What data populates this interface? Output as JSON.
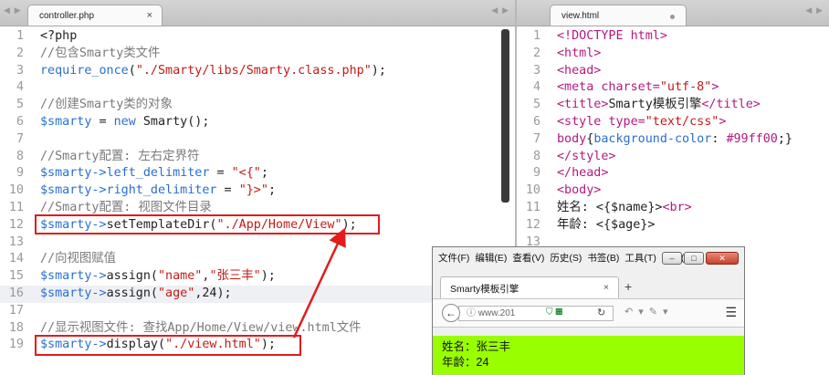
{
  "left_editor": {
    "tab_title": "controller.php",
    "tab_close": "×",
    "lines": [
      {
        "n": "1",
        "segs": [
          [
            "",
            "<?php"
          ]
        ]
      },
      {
        "n": "2",
        "segs": [
          [
            "com",
            "//包含Smarty类文件"
          ]
        ]
      },
      {
        "n": "3",
        "segs": [
          [
            "fn",
            "require_once"
          ],
          [
            "",
            "("
          ],
          [
            "str",
            "\"./Smarty/libs/Smarty.class.php\""
          ],
          [
            "",
            ");"
          ]
        ]
      },
      {
        "n": "4",
        "segs": []
      },
      {
        "n": "5",
        "segs": [
          [
            "com",
            "//创建Smarty类的对象"
          ]
        ]
      },
      {
        "n": "6",
        "segs": [
          [
            "var",
            "$smarty"
          ],
          [
            "",
            " = "
          ],
          [
            "kw",
            "new"
          ],
          [
            "",
            " Smarty();"
          ]
        ]
      },
      {
        "n": "7",
        "segs": []
      },
      {
        "n": "8",
        "segs": [
          [
            "com",
            "//Smarty配置: 左右定界符"
          ]
        ]
      },
      {
        "n": "9",
        "segs": [
          [
            "var",
            "$smarty->"
          ],
          [
            "fn",
            "left_delimiter"
          ],
          [
            "",
            " = "
          ],
          [
            "str",
            "\"<{\""
          ],
          [
            "",
            ";"
          ]
        ]
      },
      {
        "n": "10",
        "segs": [
          [
            "var",
            "$smarty->"
          ],
          [
            "fn",
            "right_delimiter"
          ],
          [
            "",
            " = "
          ],
          [
            "str",
            "\"}>\""
          ],
          [
            "",
            ";"
          ]
        ]
      },
      {
        "n": "11",
        "segs": [
          [
            "com",
            "//Smarty配置: 视图文件目录"
          ]
        ]
      },
      {
        "n": "12",
        "segs": [
          [
            "var",
            "$smarty->"
          ],
          [
            "",
            "setTemplateDir("
          ],
          [
            "str",
            "\"./App/Home/View\""
          ],
          [
            "",
            ");"
          ]
        ]
      },
      {
        "n": "13",
        "segs": []
      },
      {
        "n": "14",
        "segs": [
          [
            "com",
            "//向视图赋值"
          ]
        ]
      },
      {
        "n": "15",
        "segs": [
          [
            "var",
            "$smarty->"
          ],
          [
            "",
            "assign("
          ],
          [
            "str",
            "\"name\""
          ],
          [
            "",
            ","
          ],
          [
            "str",
            "\"张三丰\""
          ],
          [
            "",
            ");"
          ]
        ]
      },
      {
        "n": "16",
        "segs": [
          [
            "var",
            "$smarty->"
          ],
          [
            "",
            "assign("
          ],
          [
            "str",
            "\"age\""
          ],
          [
            "",
            ",24);"
          ]
        ],
        "active": true
      },
      {
        "n": "17",
        "segs": []
      },
      {
        "n": "18",
        "segs": [
          [
            "com",
            "//显示视图文件: 查找App/Home/View/view.html文件"
          ]
        ]
      },
      {
        "n": "19",
        "segs": [
          [
            "var",
            "$smarty->"
          ],
          [
            "",
            "display("
          ],
          [
            "str",
            "\"./view.html\""
          ],
          [
            "",
            ");"
          ]
        ]
      }
    ]
  },
  "right_editor": {
    "tab_title": "view.html",
    "lines": [
      {
        "n": "1",
        "segs": [
          [
            "tag",
            "<!DOCTYPE html>"
          ]
        ]
      },
      {
        "n": "2",
        "segs": [
          [
            "tag",
            "<html>"
          ]
        ]
      },
      {
        "n": "3",
        "segs": [
          [
            "tag",
            "<head>"
          ]
        ]
      },
      {
        "n": "4",
        "segs": [
          [
            "tag",
            "<meta "
          ],
          [
            "attr",
            "charset="
          ],
          [
            "str",
            "\"utf-8\""
          ],
          [
            "tag",
            ">"
          ]
        ]
      },
      {
        "n": "5",
        "segs": [
          [
            "tag",
            "<title>"
          ],
          [
            "",
            "Smarty模板引擎"
          ],
          [
            "tag",
            "</title>"
          ]
        ]
      },
      {
        "n": "6",
        "segs": [
          [
            "tag",
            "<style "
          ],
          [
            "attr",
            "type="
          ],
          [
            "str",
            "\"text/css\""
          ],
          [
            "tag",
            ">"
          ]
        ]
      },
      {
        "n": "7",
        "segs": [
          [
            "tag",
            "body"
          ],
          [
            "",
            "{"
          ],
          [
            "fn",
            "background-color"
          ],
          [
            "",
            ": "
          ],
          [
            "tag",
            "#99ff00"
          ],
          [
            "",
            ";}"
          ]
        ]
      },
      {
        "n": "8",
        "segs": [
          [
            "tag",
            "</style>"
          ]
        ]
      },
      {
        "n": "9",
        "segs": [
          [
            "tag",
            "</head>"
          ]
        ]
      },
      {
        "n": "10",
        "segs": [
          [
            "tag",
            "<body>"
          ]
        ]
      },
      {
        "n": "11",
        "segs": [
          [
            "",
            "姓名: <{$name}>"
          ],
          [
            "tag",
            "<br>"
          ]
        ]
      },
      {
        "n": "12",
        "segs": [
          [
            "",
            "年龄: <{$age}>"
          ]
        ]
      },
      {
        "n": "13",
        "segs": []
      }
    ]
  },
  "browser": {
    "menu": [
      "文件(F)",
      "编辑(E)",
      "查看(V)",
      "历史(S)",
      "书签(B)",
      "工具(T)",
      "帮助(H)"
    ],
    "tab_title": "Smarty模板引擎",
    "tab_close": "×",
    "new_tab": "+",
    "url": "www.201",
    "minimize": "–",
    "maximize": "□",
    "close": "✕",
    "content_line1": "姓名：张三丰",
    "content_line2": "年龄：24"
  },
  "colors": {
    "annotation": "#e21b1b",
    "page_background": "#99ff00"
  }
}
